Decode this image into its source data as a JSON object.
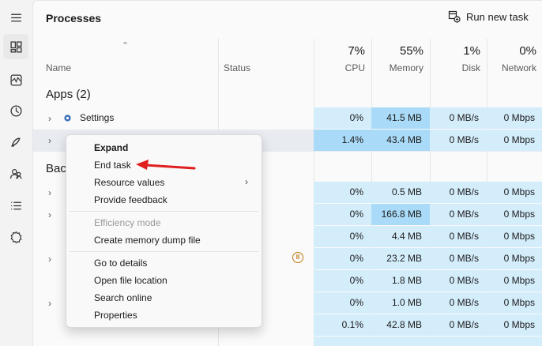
{
  "header": {
    "title": "Processes",
    "run_new_task": "Run new task"
  },
  "columns": {
    "name": "Name",
    "status": "Status",
    "cpu": {
      "pct": "7%",
      "label": "CPU"
    },
    "memory": {
      "pct": "55%",
      "label": "Memory"
    },
    "disk": {
      "pct": "1%",
      "label": "Disk"
    },
    "network": {
      "pct": "0%",
      "label": "Network"
    }
  },
  "groups": {
    "apps": "Apps (2)",
    "background": "Bac"
  },
  "rows": [
    {
      "name": "Settings",
      "cpu": "0%",
      "memory": "41.5 MB",
      "disk": "0 MB/s",
      "network": "0 Mbps"
    },
    {
      "name": "",
      "cpu": "1.4%",
      "memory": "43.4 MB",
      "disk": "0 MB/s",
      "network": "0 Mbps"
    },
    {
      "name": "",
      "cpu": "0%",
      "memory": "0.5 MB",
      "disk": "0 MB/s",
      "network": "0 Mbps"
    },
    {
      "name": "",
      "cpu": "0%",
      "memory": "166.8 MB",
      "disk": "0 MB/s",
      "network": "0 Mbps"
    },
    {
      "name": "",
      "cpu": "0%",
      "memory": "4.4 MB",
      "disk": "0 MB/s",
      "network": "0 Mbps"
    },
    {
      "name": "",
      "cpu": "0%",
      "memory": "23.2 MB",
      "disk": "0 MB/s",
      "network": "0 Mbps"
    },
    {
      "name": "",
      "cpu": "0%",
      "memory": "1.8 MB",
      "disk": "0 MB/s",
      "network": "0 Mbps"
    },
    {
      "name": "",
      "cpu": "0%",
      "memory": "1.0 MB",
      "disk": "0 MB/s",
      "network": "0 Mbps"
    },
    {
      "name": "",
      "cpu": "0.1%",
      "memory": "42.8 MB",
      "disk": "0 MB/s",
      "network": "0 Mbps"
    }
  ],
  "context_menu": {
    "expand": "Expand",
    "end_task": "End task",
    "resource_values": "Resource values",
    "provide_feedback": "Provide feedback",
    "efficiency_mode": "Efficiency mode",
    "create_dump": "Create memory dump file",
    "go_to_details": "Go to details",
    "open_file_location": "Open file location",
    "search_online": "Search online",
    "properties": "Properties"
  },
  "colors": {
    "usage_light": "#d4edfb",
    "usage_medium": "#a9daf7",
    "arrow": "#e02020",
    "selected_row": "#e8ebf0"
  }
}
